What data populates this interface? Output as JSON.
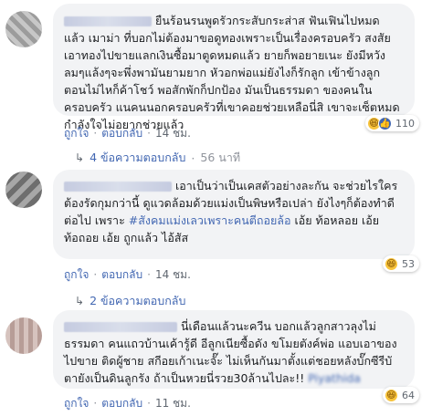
{
  "comments": [
    {
      "text": "ยืนร้อนรนพูดรัวกระสับกระส่าส ฟันเฟินไปหมด แล้ว เมาม่า ที่บอกไม่ต้องมาขอดูทองเพราะเป็นเรื่องครอบครัว สงสัยเอาทองไปขายแลกเงินซื้อมาตูดหมดแล้ว ยายก็พอยายเนะ ยังมีหวังลมๆแล้งๆจะพึ่งพามันยามยาก หัวอกพ่อแม่ยังไงก็รักลูก เข้าข้างลูก ตอนไม่ไหก็ค้าโชว์ พอสักพักก็ปกป้อง มันเป็นธรรมดา ของคนในครอบครัว แนคนนอกครอบครัวที่เขาคอยช่วยเหลือนี่สิ เขาจะเซ็ตหมดกำลังใจไม่อยากช่วยแล้ว",
      "reactions_count": "110",
      "like_label": "ถูกใจ",
      "reply_label": "ตอบกลับ",
      "time": "14 ชม.",
      "replies_label": "4 ข้อความตอบกลับ",
      "replies_time": "56 นาที"
    },
    {
      "text": "เอาเป็นว่าเป็นเคสตัวอย่างละกัน จะช่วยไรใครต้องรัดกุมกว่านี้ ดูแวดล้อมด้วยแม่งเป็นพิษหรือเปล่า ยังไงๆก็ต้องทำดีต่อไป เพราะ",
      "hashtag": "#สังคมแม่งเลวเพราะคนตีถอยล้อ",
      "text_after": " เอ้ย ท้อหลอย เอ้ย ท้อถอย เอ้ย ถูกแล้ว ไอ้สัส",
      "reactions_count": "53",
      "like_label": "ถูกใจ",
      "reply_label": "ตอบกลับ",
      "time": "14 ชม.",
      "replies_label": "2 ข้อความตอบกลับ"
    },
    {
      "text": "นี่เดือนแล้วนะควีน บอกแล้วลูกสาวลุงไม่ธรรมดา คนแถวบ้านเค้ารู้ดี อีลูกเนียซื้อดัง ขโมยตังค์พ่อ แอบเอาของไปขาย ติดผู้ชาย สกีอยเก้าเนะจั๊ะ ไม่เห็นกันมาตั้งแต่ชอยหลังบั๊กซีรีบัตายังเป็นดินลูกรัง ถ้าเป็นหวยนี่รวย30ล้านไปละ!!",
      "mention": "Piyathida Prompuang",
      "reactions_count": "64",
      "like_label": "ถูกใจ",
      "reply_label": "ตอบกลับ",
      "time": "11 ชม."
    }
  ]
}
